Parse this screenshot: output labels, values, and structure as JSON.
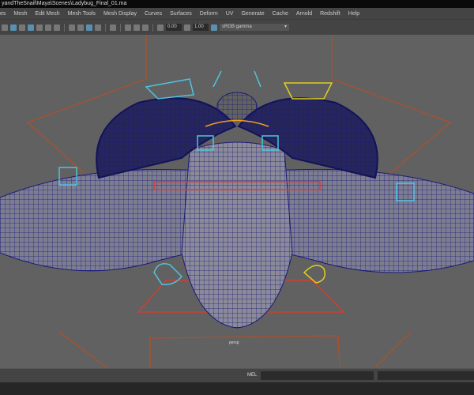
{
  "title": "yandTheSnail\\Maya\\Scenes\\Ladybug_Final_01.ma",
  "menu": [
    "es",
    "Mesh",
    "Edit Mesh",
    "Mesh Tools",
    "Mesh Display",
    "Curves",
    "Surfaces",
    "Deform",
    "UV",
    "Generate",
    "Cache",
    "Arnold",
    "Redshift",
    "Help"
  ],
  "toolbar": {
    "exposure": "0.00",
    "gamma": "1.00",
    "color_management": "sRGB gamma"
  },
  "viewport": {
    "camera": "persp"
  },
  "command": {
    "label": "MEL"
  }
}
